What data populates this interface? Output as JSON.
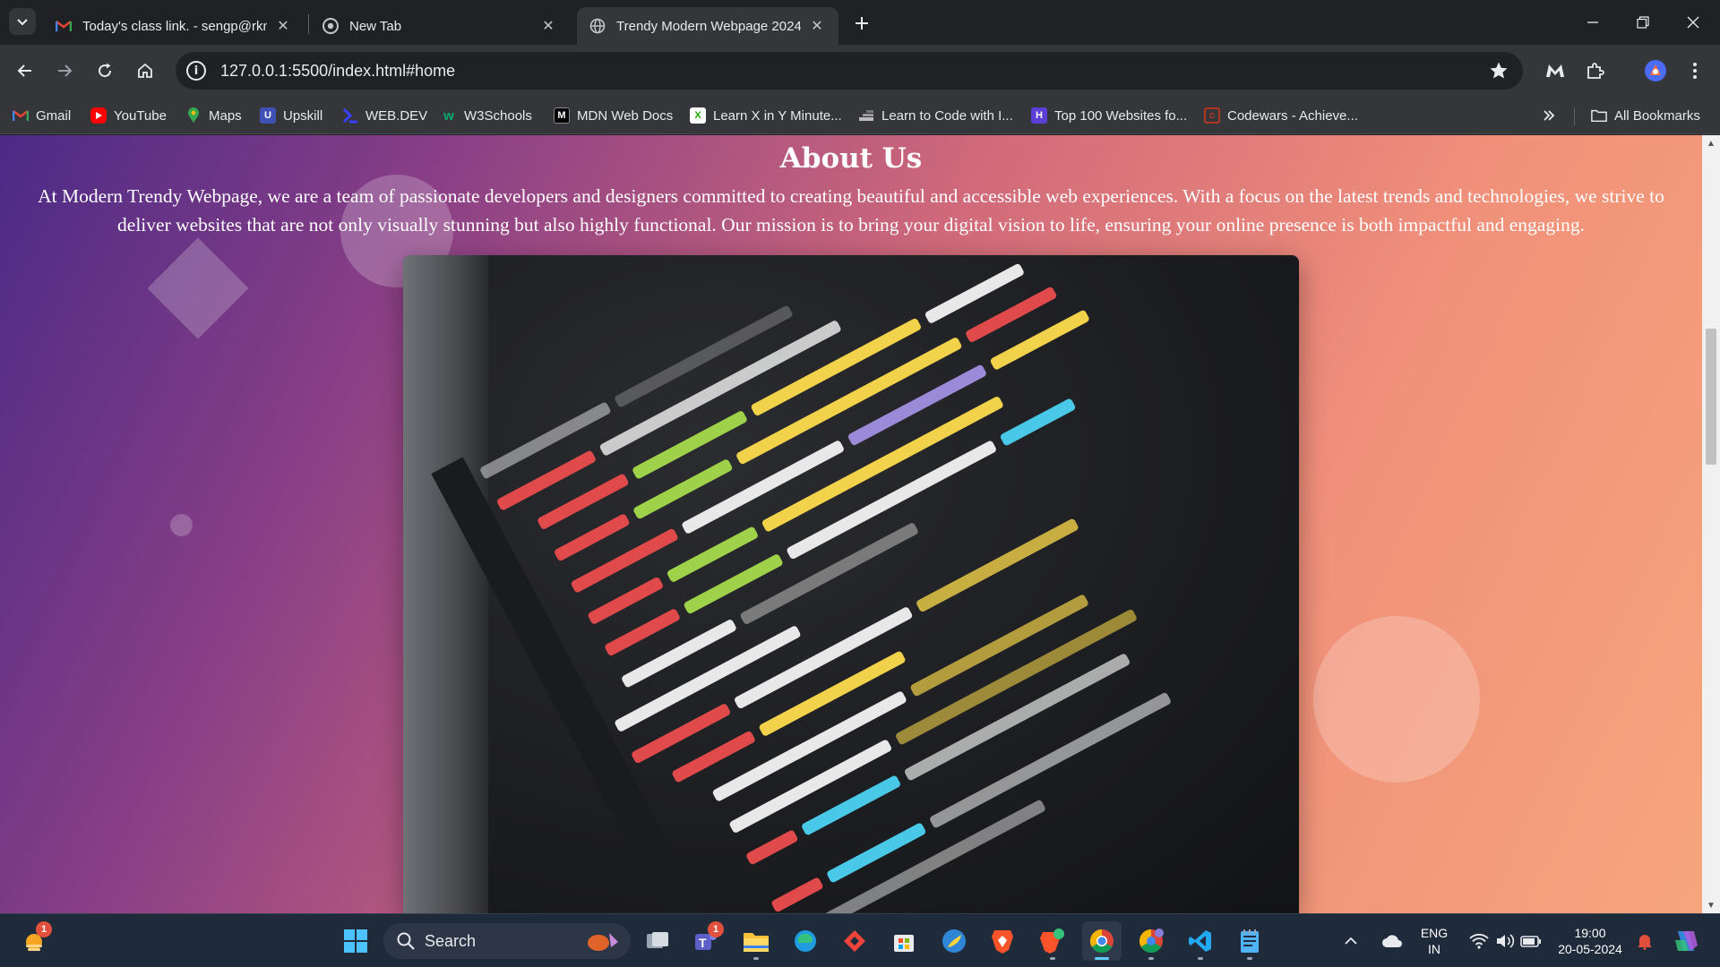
{
  "browser": {
    "tabs": [
      {
        "title": "Today's class link. - sengp@rkn",
        "active": false,
        "favicon": "gmail-icon"
      },
      {
        "title": "New Tab",
        "active": false,
        "favicon": "chrome-icon"
      },
      {
        "title": "Trendy Modern Webpage 2024",
        "active": true,
        "favicon": "globe-icon"
      }
    ],
    "url": "127.0.0.1:5500/index.html#home",
    "bookmarks": [
      {
        "label": "Gmail",
        "icon": "gmail-icon",
        "color": "#ea4335"
      },
      {
        "label": "YouTube",
        "icon": "youtube-icon",
        "color": "#ff0000"
      },
      {
        "label": "Maps",
        "icon": "maps-icon",
        "color": "#34a853"
      },
      {
        "label": "Upskill",
        "icon": "upskill-icon",
        "color": "#3f51b5"
      },
      {
        "label": "WEB.DEV",
        "icon": "webdev-icon",
        "color": "#3740ff"
      },
      {
        "label": "W3Schools",
        "icon": "w3schools-icon",
        "color": "#04aa6d"
      },
      {
        "label": "MDN Web Docs",
        "icon": "mdn-icon",
        "color": "#000000"
      },
      {
        "label": "Learn X in Y Minute...",
        "icon": "learnx-icon",
        "color": "#1faa00"
      },
      {
        "label": "Learn to Code with I...",
        "icon": "learncode-icon",
        "color": "#555555"
      },
      {
        "label": "Top 100 Websites fo...",
        "icon": "top100-icon",
        "color": "#5b3fd6"
      },
      {
        "label": "Codewars - Achieve...",
        "icon": "codewars-icon",
        "color": "#b1361e"
      }
    ],
    "all_bookmarks": "All Bookmarks"
  },
  "page": {
    "about_title": "About Us",
    "about_text": "At Modern Trendy Webpage, we are a team of passionate developers and designers committed to creating beautiful and accessible web experiences. With a focus on the latest trends and technologies, we strive to deliver websites that are not only visually stunning but also highly functional. Our mission is to bring your digital vision to life, ensuring your online presence is both impactful and engaging.",
    "colors": {
      "gradient_start": "#4b2a86",
      "gradient_mid": "#d16a7a",
      "gradient_end": "#f7a67c"
    }
  },
  "taskbar": {
    "search_label": "Search",
    "widget_badge": "1",
    "teams_badge": "1",
    "lang_line1": "ENG",
    "lang_line2": "IN",
    "time": "19:00",
    "date": "20-05-2024"
  }
}
